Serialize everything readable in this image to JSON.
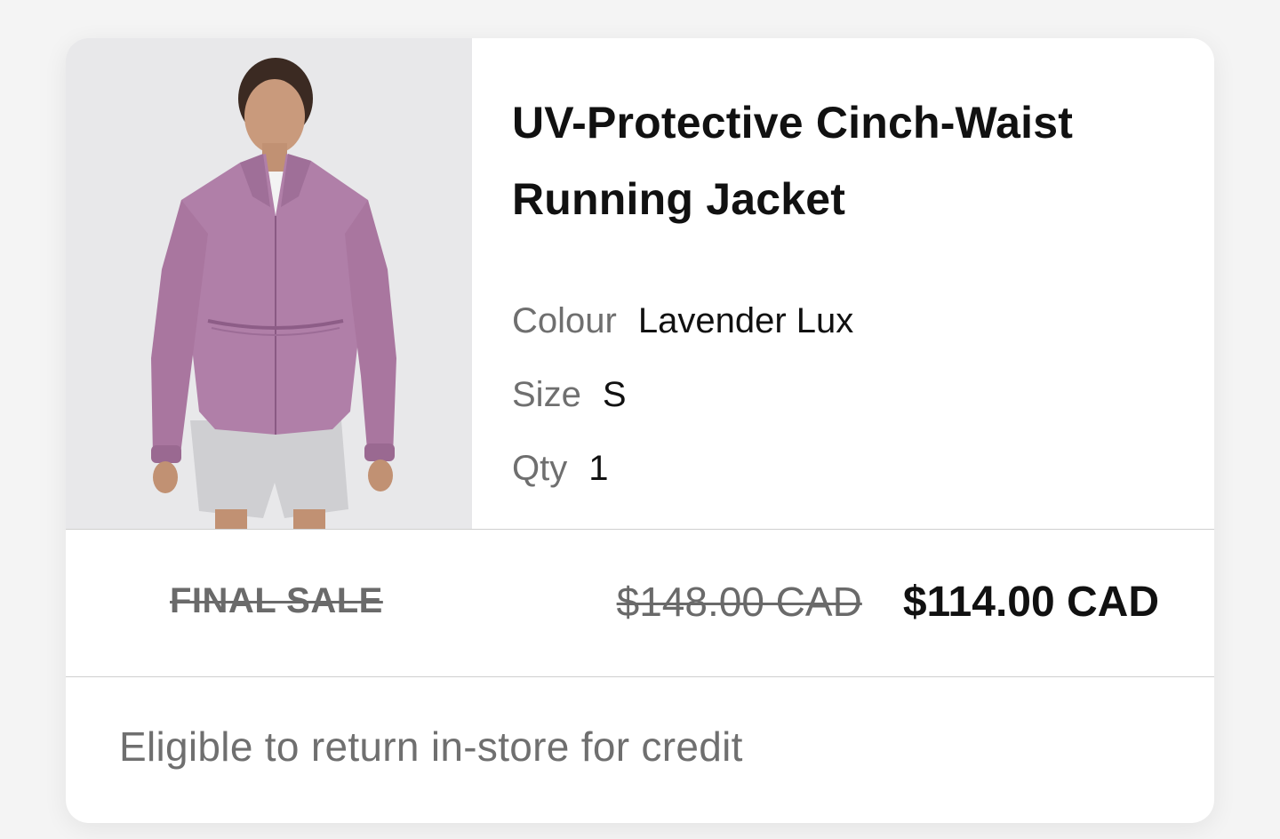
{
  "product": {
    "title": "UV-Protective Cinch-Waist Running Jacket",
    "image_alt": "Model wearing lavender cinch-waist running jacket and grey shorts",
    "attributes": [
      {
        "label": "Colour",
        "value": "Lavender Lux"
      },
      {
        "label": "Size",
        "value": "S"
      },
      {
        "label": "Qty",
        "value": "1"
      }
    ]
  },
  "pricing": {
    "final_sale_label": "FINAL SALE",
    "original_price": "$148.00 CAD",
    "sale_price": "$114.00 CAD"
  },
  "returns": {
    "note": "Eligible to return in-store for credit"
  },
  "colors": {
    "jacket": "#b07fa8",
    "background": "#f4f4f4",
    "card": "#ffffff",
    "muted_text": "#6f6f6f"
  }
}
